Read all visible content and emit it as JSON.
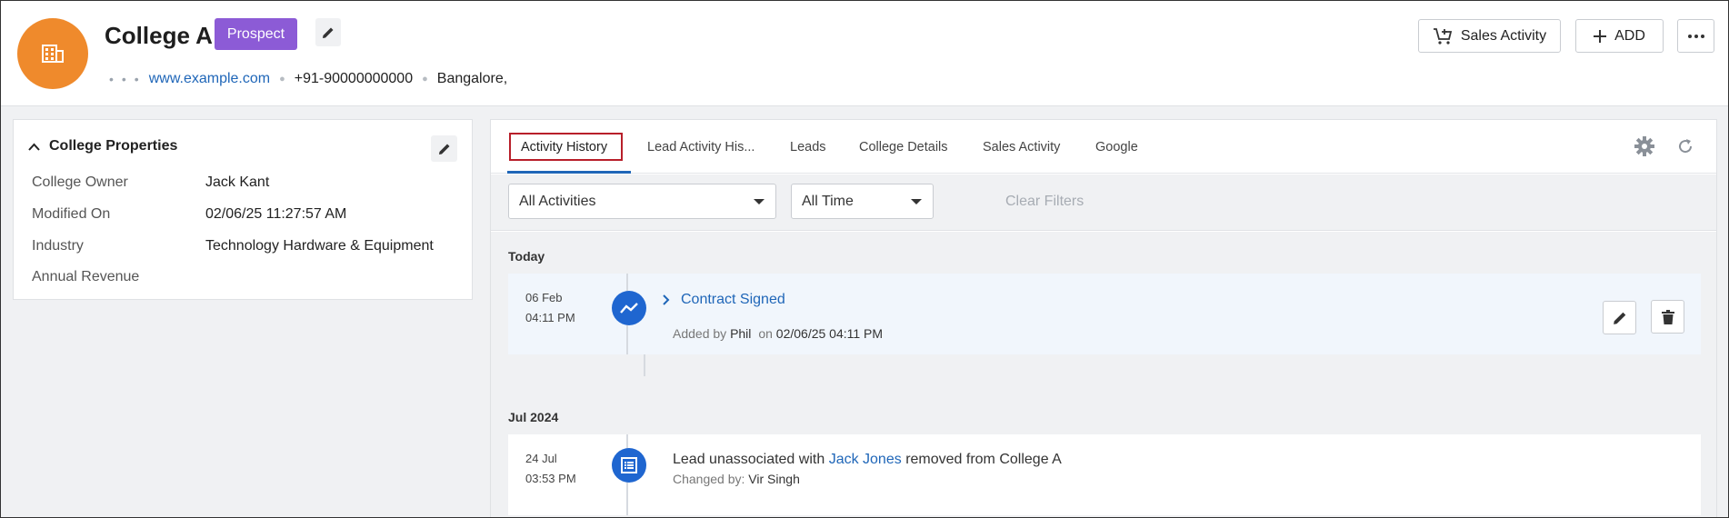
{
  "header": {
    "title": "College A",
    "status_badge": "Prospect",
    "website": "www.example.com",
    "phone": "+91-90000000000",
    "city": "Bangalore,",
    "sales_activity_label": "Sales Activity",
    "add_label": "ADD",
    "avatar_color": "#ef8a2c",
    "badge_color": "#8c5bd6"
  },
  "properties": {
    "title": "College Properties",
    "rows": [
      {
        "label": "College Owner",
        "value": "Jack Kant"
      },
      {
        "label": "Modified On",
        "value": "02/06/25 11:27:57 AM"
      },
      {
        "label": "Industry",
        "value": "Technology Hardware & Equipment"
      },
      {
        "label": "Annual Revenue",
        "value": ""
      }
    ]
  },
  "tabs": [
    {
      "label": "Activity History",
      "active": true
    },
    {
      "label": "Lead Activity His..."
    },
    {
      "label": "Leads"
    },
    {
      "label": "College Details"
    },
    {
      "label": "Sales Activity"
    },
    {
      "label": "Google"
    }
  ],
  "filters": {
    "activities": "All Activities",
    "time": "All Time",
    "clear": "Clear Filters"
  },
  "feed": {
    "groups": [
      {
        "label": "Today",
        "items": [
          {
            "date": "06 Feb",
            "time": "04:11 PM",
            "title": "Contract Signed",
            "added_by_prefix": "Added by",
            "added_by": "Phil",
            "on_prefix": "on",
            "on_date": "02/06/25 04:11 PM"
          }
        ]
      },
      {
        "label": "Jul 2024",
        "items": [
          {
            "date": "24 Jul",
            "time": "03:53 PM",
            "text_before": "Lead unassociated with",
            "link": "Jack Jones",
            "text_after": "removed from College A",
            "changed_by_prefix": "Changed by:",
            "changed_by": "Vir Singh"
          }
        ]
      }
    ]
  }
}
